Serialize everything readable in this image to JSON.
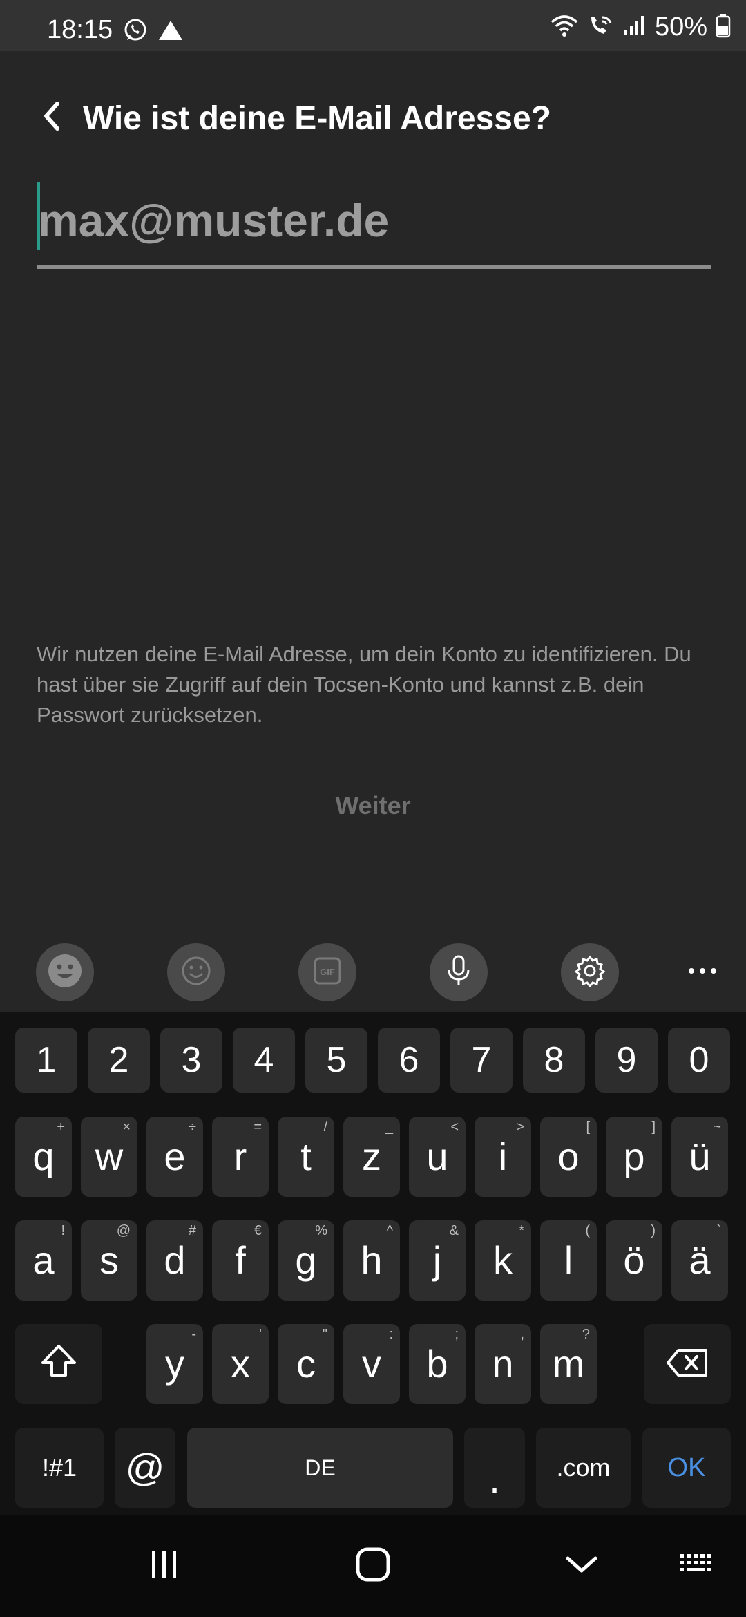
{
  "status_bar": {
    "time": "18:15",
    "battery": "50%"
  },
  "header": {
    "title": "Wie ist deine E-Mail Adresse?"
  },
  "email": {
    "placeholder": "max@muster.de",
    "value": ""
  },
  "info": {
    "text": "Wir nutzen deine E-Mail Adresse, um dein Konto zu identifizieren. Du hast über sie Zugriff auf dein Tocsen-Konto und kannst z.B. dein Passwort zurücksetzen."
  },
  "next_button": {
    "label": "Weiter"
  },
  "keyboard": {
    "numbers": [
      "1",
      "2",
      "3",
      "4",
      "5",
      "6",
      "7",
      "8",
      "9",
      "0"
    ],
    "row1": [
      {
        "key": "q",
        "hint": "+"
      },
      {
        "key": "w",
        "hint": "×"
      },
      {
        "key": "e",
        "hint": "÷"
      },
      {
        "key": "r",
        "hint": "="
      },
      {
        "key": "t",
        "hint": "/"
      },
      {
        "key": "z",
        "hint": "_"
      },
      {
        "key": "u",
        "hint": "<"
      },
      {
        "key": "i",
        "hint": ">"
      },
      {
        "key": "o",
        "hint": "["
      },
      {
        "key": "p",
        "hint": "]"
      },
      {
        "key": "ü",
        "hint": "~"
      }
    ],
    "row2": [
      {
        "key": "a",
        "hint": "!"
      },
      {
        "key": "s",
        "hint": "@"
      },
      {
        "key": "d",
        "hint": "#"
      },
      {
        "key": "f",
        "hint": "€"
      },
      {
        "key": "g",
        "hint": "%"
      },
      {
        "key": "h",
        "hint": "^"
      },
      {
        "key": "j",
        "hint": "&"
      },
      {
        "key": "k",
        "hint": "*"
      },
      {
        "key": "l",
        "hint": "("
      },
      {
        "key": "ö",
        "hint": ")"
      },
      {
        "key": "ä",
        "hint": "`"
      }
    ],
    "row3": [
      {
        "key": "y",
        "hint": "-"
      },
      {
        "key": "x",
        "hint": "'"
      },
      {
        "key": "c",
        "hint": "\""
      },
      {
        "key": "v",
        "hint": ":"
      },
      {
        "key": "b",
        "hint": ";"
      },
      {
        "key": "n",
        "hint": ","
      },
      {
        "key": "m",
        "hint": "?"
      }
    ],
    "symbols_label": "!#1",
    "at_label": "@",
    "space_label": "DE",
    "period_label": ".",
    "dotcom_label": ".com",
    "ok_label": "OK"
  },
  "icons": {
    "accent_color": "#2c9c8a",
    "ok_color": "#4a90e2"
  }
}
